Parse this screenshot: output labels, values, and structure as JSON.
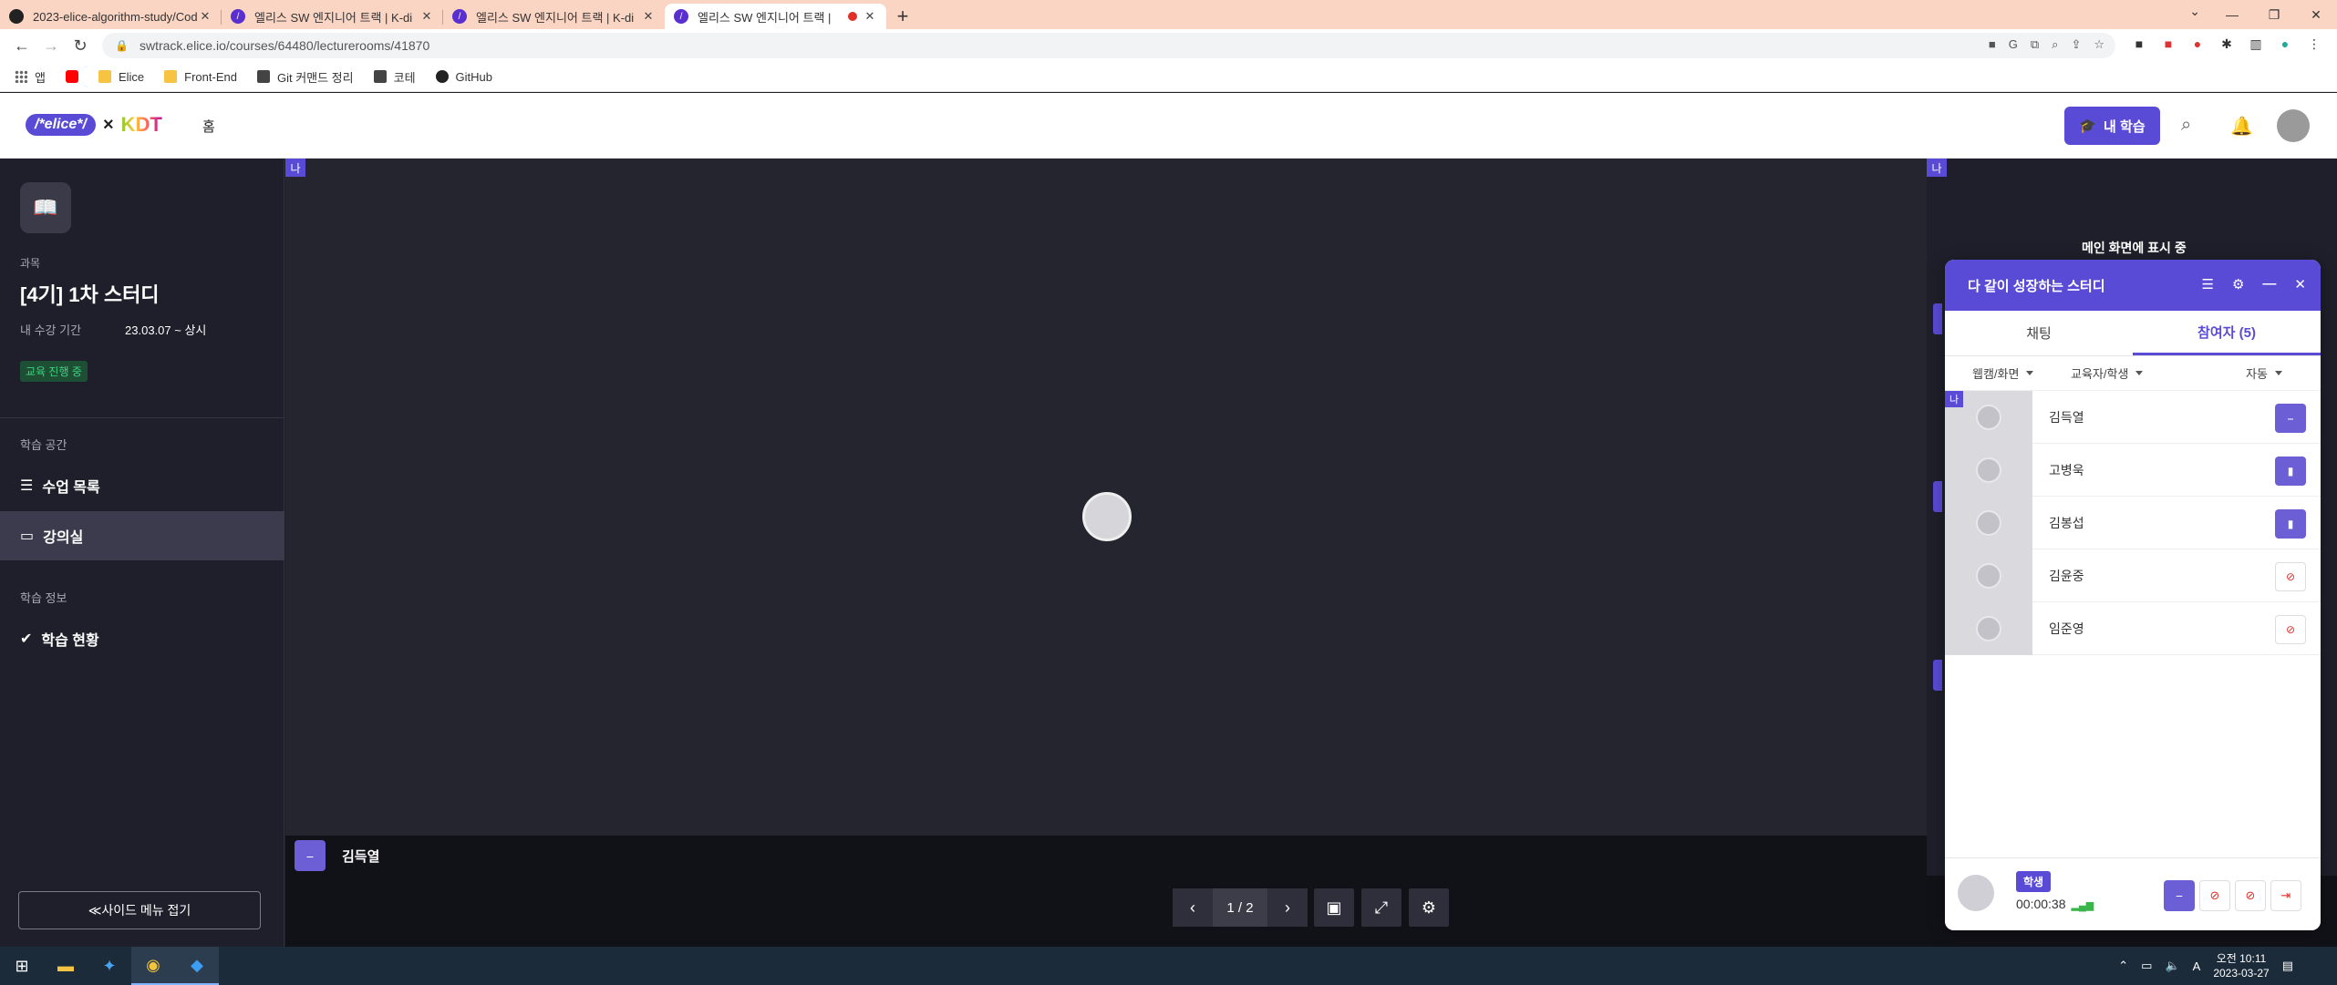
{
  "browser": {
    "tabs": [
      {
        "title": "2023-elice-algorithm-study/Cod",
        "favicon": "github-icon"
      },
      {
        "title": "엘리스 SW 엔지니어 트랙 | K-di",
        "favicon": "elice-icon"
      },
      {
        "title": "엘리스 SW 엔지니어 트랙 | K-di",
        "favicon": "elice-icon"
      },
      {
        "title": "엘리스 SW 엔지니어 트랙 |",
        "favicon": "elice-icon",
        "active": true,
        "recording": true
      }
    ],
    "url": "swtrack.elice.io/courses/64480/lecturerooms/41870",
    "bookmarks": [
      "앱",
      "",
      "Elice",
      "Front-End",
      "Git 커맨드 정리",
      "코테",
      "GitHub"
    ]
  },
  "header": {
    "logo_text": "/*elice*/",
    "logo_times": "×",
    "logo_kdt": "KDT",
    "home": "홈",
    "my_learning": "내 학습"
  },
  "sidebar": {
    "course_label": "과목",
    "course_title": "[4기] 1차 스터디",
    "period_label": "내 수강 기간",
    "period_value": "23.03.07 ~ 상시",
    "status_badge": "교육 진행 중",
    "section_learning_space": "학습 공간",
    "item_class_list": "수업 목록",
    "item_lecture_room": "강의실",
    "section_learning_info": "학습 정보",
    "item_progress": "학습 현황",
    "collapse": "≪사이드 메뉴 접기"
  },
  "stage": {
    "me_tag": "나",
    "speaker_name": "김득열",
    "page_indicator": "1 / 2"
  },
  "right_panel": {
    "me_tag": "나",
    "main_screen_label": "메인 화면에 표시 중"
  },
  "participants_panel": {
    "title": "다 같이 성장하는 스터디",
    "tab_chat": "채팅",
    "tab_participants": "참여자 (5)",
    "filter_media": "웹캠/화면",
    "filter_role": "교육자/학생",
    "filter_sort": "자동",
    "participants": [
      {
        "name": "김득열",
        "mic": "on",
        "me": true
      },
      {
        "name": "고병욱",
        "mic": "on"
      },
      {
        "name": "김봉섭",
        "mic": "on"
      },
      {
        "name": "김윤중",
        "mic": "off"
      },
      {
        "name": "임준영",
        "mic": "off"
      }
    ],
    "footer_role": "학생",
    "footer_timer": "00:00:38"
  },
  "taskbar": {
    "time": "오전 10:11",
    "date": "2023-03-27",
    "ime": "A"
  }
}
